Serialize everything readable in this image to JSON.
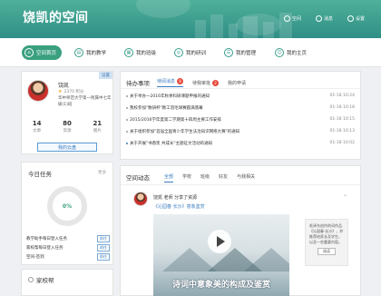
{
  "header": {
    "title": "饶凯的空间",
    "tools": [
      "空间",
      "消息",
      "设置"
    ]
  },
  "nav": {
    "items": [
      "空间首页",
      "我的教学",
      "我的班级",
      "我的研训",
      "我的管理",
      "我的主页"
    ]
  },
  "profile": {
    "tag": "设置",
    "name": "饶凯",
    "points": "2370 积分",
    "school": "华中师范大学第一附属中七年级(1)班",
    "stats": [
      {
        "n": "14",
        "l": "文章"
      },
      {
        "n": "80",
        "l": "资源"
      },
      {
        "n": "21",
        "l": "图片"
      }
    ],
    "button": "我的云盘"
  },
  "tasks": {
    "title": "今日任务",
    "more": "更多",
    "percent": "0%",
    "rows": [
      {
        "label": "教学助手每日登入任务",
        "action": "前往"
      },
      {
        "label": "家校帮每日登入任务",
        "action": "前往"
      },
      {
        "label": "空间-签到",
        "action": "前往"
      }
    ]
  },
  "alumni": {
    "title": "家校帮"
  },
  "todo": {
    "title": "待办事项",
    "tabs": [
      {
        "label": "待阅消息",
        "badge": "8"
      },
      {
        "label": "待我审批",
        "badge": "2"
      },
      {
        "label": "我的申请",
        "badge": ""
      }
    ],
    "items": [
      {
        "text": "关于举办一2016年秋季科研课题申报的通知",
        "date": "01-18 10:24"
      },
      {
        "text": "我校参加\"数研杯\"教工羽毛球赛圆满落幕",
        "date": "01-18 10:18"
      },
      {
        "text": "2015/2016学年度第二学期第十四周主要工作安排",
        "date": "01-18 10:15"
      },
      {
        "text": "关于组织参加\"首届全国青少年学生法治知识网络大赛\"的通知",
        "date": "01-18 10:13"
      },
      {
        "text": "关于开展\"书香凯 共成长\"主题征文活动的通知",
        "date": "01-18 10:02"
      }
    ]
  },
  "dynamics": {
    "title": "空间动态",
    "tabs": [
      "全部",
      "学校",
      "班级",
      "好友",
      "与我相关"
    ],
    "poster": "饶凯 老师  分享了资源",
    "link": "《沁园春 长沙》意象鉴赏",
    "caption": "诗词中意象美的构成及鉴赏",
    "side_text": "毛泽东创作的词作品《沁园春·长沙》，并推荐给家长及学生，以及一些重要内容。",
    "side_button": "阅读"
  }
}
